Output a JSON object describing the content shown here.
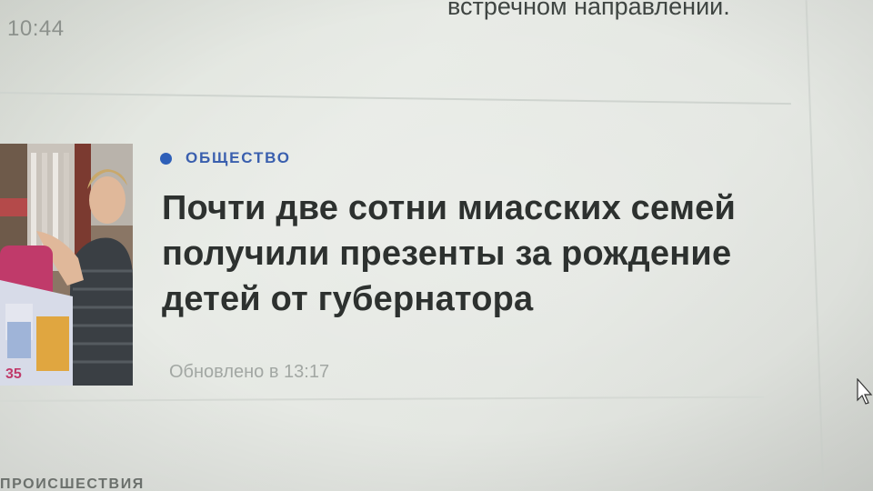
{
  "top": {
    "time": "10:44",
    "snippet": "встречном направлении."
  },
  "news_item": {
    "category": "ОБЩЕСТВО",
    "category_color": "#3a5fae",
    "headline_lines": [
      "Почти две сотни миасских семей",
      "получили презенты за рождение",
      "детей от губернатора"
    ],
    "updated": "Обновлено в 13:17",
    "thumbnail_icon": "news-photo"
  },
  "next_section": {
    "label": "ПРОИСШЕСТВИЯ"
  }
}
